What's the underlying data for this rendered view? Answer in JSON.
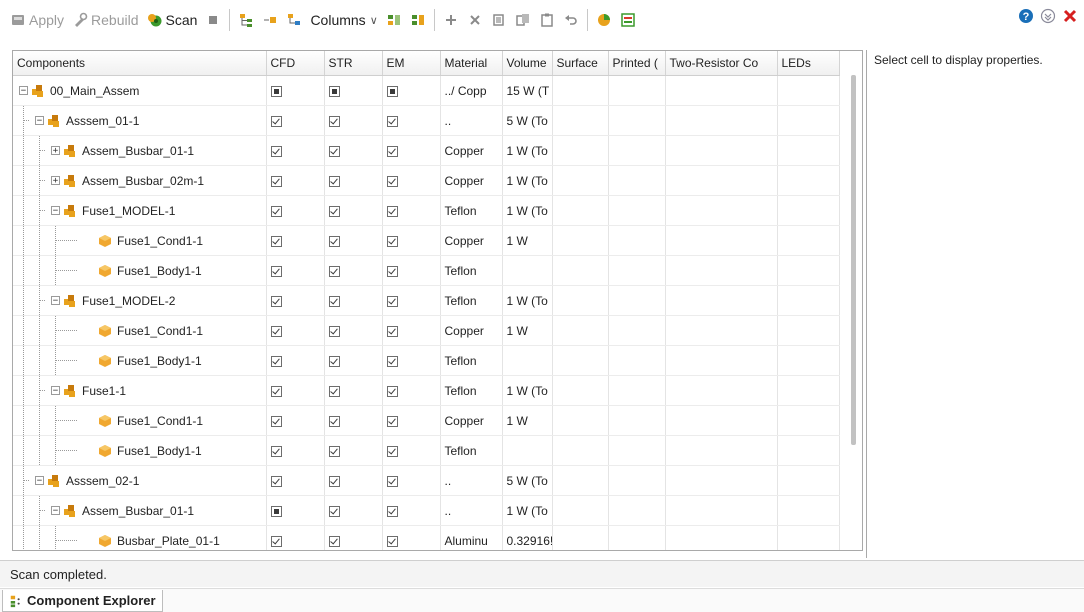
{
  "toolbar": {
    "apply_label": "Apply",
    "rebuild_label": "Rebuild",
    "scan_label": "Scan",
    "columns_label": "Columns"
  },
  "grid": {
    "columns": [
      "Components",
      "CFD",
      "STR",
      "EM",
      "Material",
      "Volume",
      "Surface",
      "Printed (",
      "Two-Resistor Co",
      "LEDs"
    ],
    "rows": [
      {
        "name": "00_Main_Assem",
        "level": 0,
        "type": "assembly",
        "expander": "minus",
        "cfd": "partial",
        "str": "partial",
        "em": "partial",
        "material": "../ Copp",
        "volume": "15 W (T"
      },
      {
        "name": "Asssem_01-1",
        "level": 1,
        "type": "assembly",
        "expander": "minus",
        "cfd": "checked",
        "str": "checked",
        "em": "checked",
        "material": "..",
        "volume": "5 W (To"
      },
      {
        "name": "Assem_Busbar_01-1",
        "level": 2,
        "type": "assembly",
        "expander": "plus",
        "cfd": "checked",
        "str": "checked",
        "em": "checked",
        "material": "Copper",
        "volume": "1 W (To"
      },
      {
        "name": "Assem_Busbar_02m-1",
        "level": 2,
        "type": "assembly",
        "expander": "plus",
        "cfd": "checked",
        "str": "checked",
        "em": "checked",
        "material": "Copper",
        "volume": "1 W (To"
      },
      {
        "name": "Fuse1_MODEL-1",
        "level": 2,
        "type": "assembly",
        "expander": "minus",
        "cfd": "checked",
        "str": "checked",
        "em": "checked",
        "material": "Teflon",
        "volume": "1 W (To"
      },
      {
        "name": "Fuse1_Cond1-1",
        "level": 3,
        "type": "part",
        "expander": "",
        "cfd": "checked",
        "str": "checked",
        "em": "checked",
        "material": "Copper",
        "volume": "1 W"
      },
      {
        "name": "Fuse1_Body1-1",
        "level": 3,
        "type": "part",
        "expander": "",
        "cfd": "checked",
        "str": "checked",
        "em": "checked",
        "material": "Teflon",
        "volume": ""
      },
      {
        "name": "Fuse1_MODEL-2",
        "level": 2,
        "type": "assembly",
        "expander": "minus",
        "cfd": "checked",
        "str": "checked",
        "em": "checked",
        "material": "Teflon",
        "volume": "1 W (To"
      },
      {
        "name": "Fuse1_Cond1-1",
        "level": 3,
        "type": "part",
        "expander": "",
        "cfd": "checked",
        "str": "checked",
        "em": "checked",
        "material": "Copper",
        "volume": "1 W"
      },
      {
        "name": "Fuse1_Body1-1",
        "level": 3,
        "type": "part",
        "expander": "",
        "cfd": "checked",
        "str": "checked",
        "em": "checked",
        "material": "Teflon",
        "volume": ""
      },
      {
        "name": "Fuse1-1",
        "level": 2,
        "type": "assembly",
        "expander": "minus",
        "cfd": "checked",
        "str": "checked",
        "em": "checked",
        "material": "Teflon",
        "volume": "1 W (To"
      },
      {
        "name": "Fuse1_Cond1-1",
        "level": 3,
        "type": "part",
        "expander": "",
        "cfd": "checked",
        "str": "checked",
        "em": "checked",
        "material": "Copper",
        "volume": "1 W"
      },
      {
        "name": "Fuse1_Body1-1",
        "level": 3,
        "type": "part",
        "expander": "",
        "cfd": "checked",
        "str": "checked",
        "em": "checked",
        "material": "Teflon",
        "volume": ""
      },
      {
        "name": "Asssem_02-1",
        "level": 1,
        "type": "assembly",
        "expander": "minus",
        "cfd": "checked",
        "str": "checked",
        "em": "checked",
        "material": "..",
        "volume": "5 W (To"
      },
      {
        "name": "Assem_Busbar_01-1",
        "level": 2,
        "type": "assembly",
        "expander": "minus",
        "cfd": "partial",
        "str": "checked",
        "em": "checked",
        "material": "..",
        "volume": "1 W (To"
      },
      {
        "name": "Busbar_Plate_01-1",
        "level": 3,
        "type": "part",
        "expander": "",
        "cfd": "checked",
        "str": "checked",
        "em": "checked",
        "material": "Aluminu",
        "volume": "0.32916!"
      }
    ]
  },
  "properties": {
    "hint": "Select cell to display properties."
  },
  "status": {
    "text": "Scan completed."
  },
  "bottom_tab": {
    "label": "Component Explorer"
  },
  "colors": {
    "assembly_icon": "#e8a21c",
    "part_icon": "#f0a830",
    "help": "#1a6fb8",
    "close": "#d61f1f"
  }
}
